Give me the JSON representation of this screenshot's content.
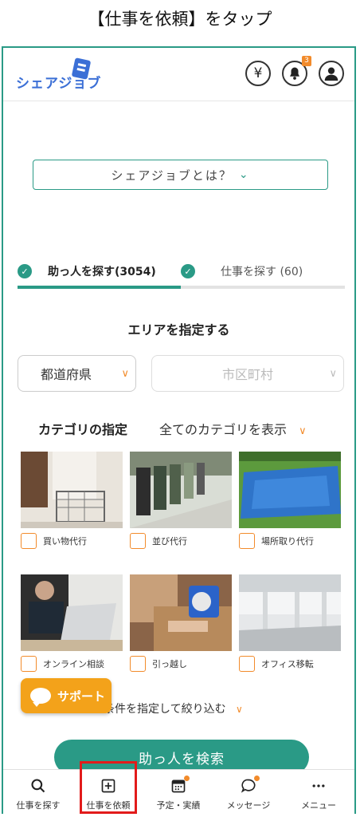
{
  "caption": "【仕事を依頼】をタップ",
  "header": {
    "logo_text": "シェアジョブ",
    "notification_count": "3",
    "yen_symbol": "¥"
  },
  "about_button": "シェアジョブとは？",
  "tabs": [
    {
      "label": "助っ人を探す(3054)",
      "active": true
    },
    {
      "label": "仕事を探す (60)",
      "active": false
    }
  ],
  "area": {
    "title": "エリアを指定する",
    "prefecture_placeholder": "都道府県",
    "city_placeholder": "市区町村"
  },
  "category": {
    "title": "カテゴリの指定",
    "show_all": "全てのカテゴリを表示",
    "items": [
      {
        "label": "買い物代行"
      },
      {
        "label": "並び代行"
      },
      {
        "label": "場所取り代行"
      },
      {
        "label": "オンライン相談"
      },
      {
        "label": "引っ越し"
      },
      {
        "label": "オフィス移転"
      }
    ]
  },
  "more_conditions": "条件を指定して絞り込む",
  "support_button": "サポート",
  "search_button": "助っ人を検索",
  "bottom_nav": [
    {
      "label": "仕事を探す",
      "icon": "search-icon"
    },
    {
      "label": "仕事を依頼",
      "icon": "plus-square-icon"
    },
    {
      "label": "予定・実績",
      "icon": "calendar-icon"
    },
    {
      "label": "メッセージ",
      "icon": "chat-icon"
    },
    {
      "label": "メニュー",
      "icon": "more-icon"
    }
  ],
  "colors": {
    "brand_green": "#2a9a86",
    "accent_orange": "#f28b2b",
    "support_orange": "#f3a21a",
    "highlight_red": "#e21b1b"
  }
}
